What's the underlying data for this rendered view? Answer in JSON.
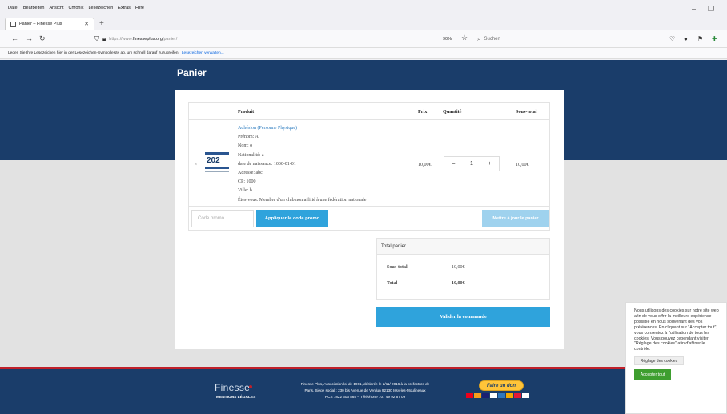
{
  "browser": {
    "menu": [
      "Datei",
      "Bearbeiten",
      "Ansicht",
      "Chronik",
      "Lesezeichen",
      "Extras",
      "Hilfe"
    ],
    "tab_title": "Panier – Finesse Plus",
    "url_prefix": "https://www.",
    "url_domain": "finesseplus.org",
    "url_path": "/panier/",
    "zoom": "90%",
    "search_placeholder": "Suchen",
    "bookmark_text": "Legen Sie Ihre Lesezeichen hier in der Lesezeichen-Symbolleiste ab, um schnell darauf zuzugreifen.",
    "bookmark_link": "Lesezeichen verwalten..."
  },
  "page": {
    "title": "Panier",
    "cart": {
      "headers": {
        "product": "Produit",
        "price": "Prix",
        "quantity": "Quantité",
        "subtotal": "Sous-total"
      },
      "item": {
        "name": "Adhésion (Personne Physique)",
        "details": [
          "Prénom:  A",
          "Nom:  o",
          "Nationalité:  a",
          "date de naissance:  1000-01-01",
          "Adresse:  abc",
          "CP:  1000",
          "Ville:  b",
          "Êtes-vous:  Membre d'un club non affilié à une fédération nationale"
        ],
        "thumb_text": "202",
        "price": "10,00€",
        "quantity": "1",
        "subtotal": "10,00€"
      },
      "coupon_placeholder": "Code promo",
      "apply_label": "Appliquer le code promo",
      "update_label": "Mettre à jour le panier"
    },
    "totals": {
      "title": "Total panier",
      "subtotal_label": "Sous-total",
      "subtotal_value": "10,00€",
      "total_label": "Total",
      "total_value": "10,00€"
    },
    "checkout_label": "Valider la commande"
  },
  "footer": {
    "logo": "Finesse",
    "legal": "MENTIONS LÉGALES",
    "info_line1": "Finesse Plus, Association loi de 1901, déclarée le 2/11/ 2016 à la préfecture de",
    "info_line2": "Paris. Siège social : 230 bis Avenue de Verdun 92130 Issy-les-Moulineaux",
    "info_line3": "RCS : 822 603 865 – Téléphone : 07 49 92 67 09",
    "donate": "Faire un don"
  },
  "cookie": {
    "text": "Nous utilisons des cookies sur notre site web afin de vous offrir la meilleure expérience possible en nous souvenant des vos préférences. En cliquant sur \"Accepter tout\", vous consentez à l'utilisation de tous les cookies. Vous pouvez cependant visiter \"Réglage des cookies\" afin d'affiner le contrôle.",
    "settings_label": "Réglage des cookies",
    "accept_label": "Accepter tout"
  }
}
